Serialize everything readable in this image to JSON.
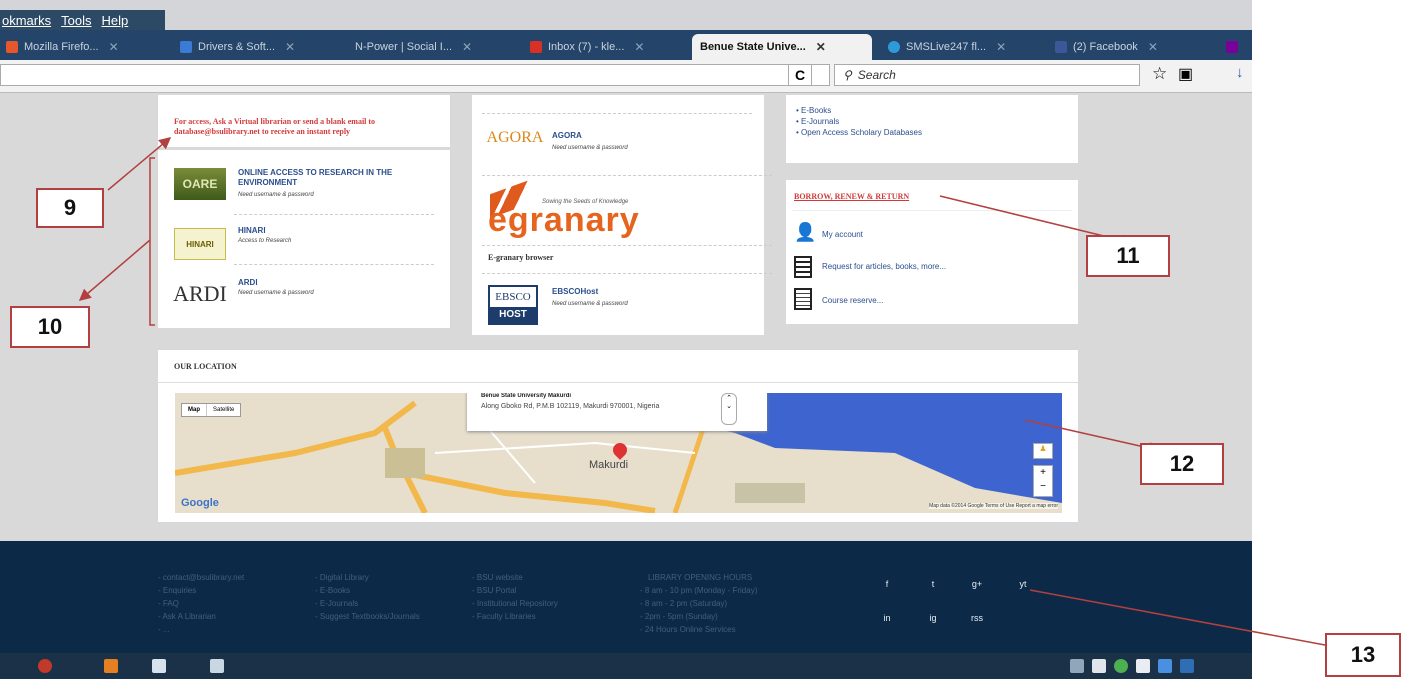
{
  "menubar": {
    "items": [
      "okmarks",
      "Tools",
      "Help"
    ]
  },
  "tabs": [
    {
      "label": "Mozilla Firefo...",
      "color": "#e7572b"
    },
    {
      "label": "Drivers & Soft...",
      "color": "#3a7bd5"
    },
    {
      "label": "N-Power | Social I...",
      "color": "#9aa9b8"
    },
    {
      "label": "Inbox (7) - kle...",
      "color": "#d93025"
    },
    {
      "label": "Benue State Unive...",
      "color": "#ffffff",
      "active": true
    },
    {
      "label": "SMSLive247 fl...",
      "color": "#2f9ad9"
    },
    {
      "label": "(2) Facebook",
      "color": "#3b5998"
    }
  ],
  "nav": {
    "reload": "C",
    "search_placeholder": "Search"
  },
  "resources": {
    "note": "For access, Ask a Virtual librarian or send a blank email to database@bsulibrary.net to receive an instant reply",
    "items": [
      {
        "logo": "OARE",
        "title": "ONLINE ACCESS TO RESEARCH IN THE ENVIRONMENT",
        "sub": "Need username & password"
      },
      {
        "logo": "HINARI",
        "title": "HINARI",
        "sub": "Access to Research"
      },
      {
        "logo": "ARDI",
        "title": "ARDI",
        "sub": "Need username & password"
      }
    ]
  },
  "middle": {
    "agora": {
      "logo": "AGORA",
      "title": "AGORA",
      "sub": "Need username & password"
    },
    "egranary": {
      "logo": "egranary",
      "tagline": "Sowing the Seeds of Knowledge",
      "label": "E-granary browser"
    },
    "ebsco": {
      "logo_top": "EBSCO",
      "logo_bottom": "HOST",
      "title": "EBSCOHost",
      "sub": "Need username & password"
    }
  },
  "right": {
    "links": [
      "E-Books",
      "E-Journals",
      "Open Access Scholary Databases"
    ],
    "borrow_title": "BORROW, RENEW & RETURN",
    "actions": [
      "My account",
      "Request for articles, books, more...",
      "Course reserve..."
    ]
  },
  "location": {
    "title": "OUR LOCATION",
    "map_btns": [
      "Map",
      "Satellite"
    ],
    "popup_title": "Benue State University Makurdi",
    "popup_addr": "Along Gboko Rd, P.M.B 102119, Makurdi 970001, Nigeria",
    "city": "Makurdi",
    "google": "Google",
    "map_footer": "Map data ©2014 Google  Terms of Use  Report a map error"
  },
  "footer": {
    "col1": [
      "contact@bsulibrary.net",
      "Enquiries",
      "FAQ",
      "Ask A Librarian",
      "..."
    ],
    "col2": [
      "Digital Library",
      "E-Books",
      "E-Journals",
      "Suggest Textbooks/Journals"
    ],
    "col3": [
      "BSU website",
      "BSU Portal",
      "Institutional Repository",
      "Faculty Libraries"
    ],
    "col4": [
      "LIBRARY OPENING HOURS",
      "8 am - 10 pm (Monday - Friday)",
      "8 am - 2 pm (Saturday)",
      "2pm - 5pm (Sunday)",
      "24 Hours Online Services"
    ],
    "social": [
      "f",
      "t",
      "g+",
      "yt",
      "in",
      "ig",
      "rss"
    ]
  },
  "annotations": [
    "9",
    "10",
    "11",
    "12",
    "13"
  ],
  "colors": {
    "annotation_red": "#b24040",
    "footer_bg": "#0c2a48",
    "tabstrip": "#24446a"
  }
}
